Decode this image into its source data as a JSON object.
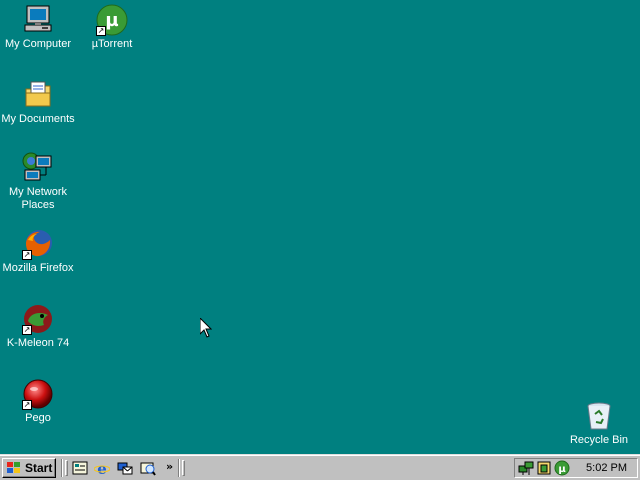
{
  "desktop": {
    "background_color": "#008080",
    "icons": [
      {
        "label": "My Computer",
        "icon": "my-computer-icon",
        "shortcut": false
      },
      {
        "label": "µTorrent",
        "icon": "utorrent-icon",
        "shortcut": true
      },
      {
        "label": "My Documents",
        "icon": "my-documents-icon",
        "shortcut": false
      },
      {
        "label": "My Network Places",
        "icon": "my-network-places-icon",
        "shortcut": false
      },
      {
        "label": "Mozilla Firefox",
        "icon": "firefox-icon",
        "shortcut": true
      },
      {
        "label": "K-Meleon 74",
        "icon": "k-meleon-icon",
        "shortcut": true
      },
      {
        "label": "Pego",
        "icon": "pego-icon",
        "shortcut": true
      },
      {
        "label": "Recycle Bin",
        "icon": "recycle-bin-icon",
        "shortcut": false
      }
    ]
  },
  "taskbar": {
    "start_label": "Start",
    "quick_launch": [
      {
        "icon": "show-desktop-icon"
      },
      {
        "icon": "internet-explorer-icon"
      },
      {
        "icon": "outlook-express-icon"
      },
      {
        "icon": "windows-media-icon"
      }
    ],
    "overflow_chevron": "»",
    "tray_icons": [
      {
        "icon": "network-tray-icon"
      },
      {
        "icon": "security-tray-icon"
      },
      {
        "icon": "utorrent-tray-icon"
      }
    ],
    "clock": "5:02 PM"
  },
  "colors": {
    "desktop": "#008080",
    "taskbar": "#c0c0c0",
    "utorrent_green": "#3a9b35",
    "firefox_orange": "#e66000"
  }
}
